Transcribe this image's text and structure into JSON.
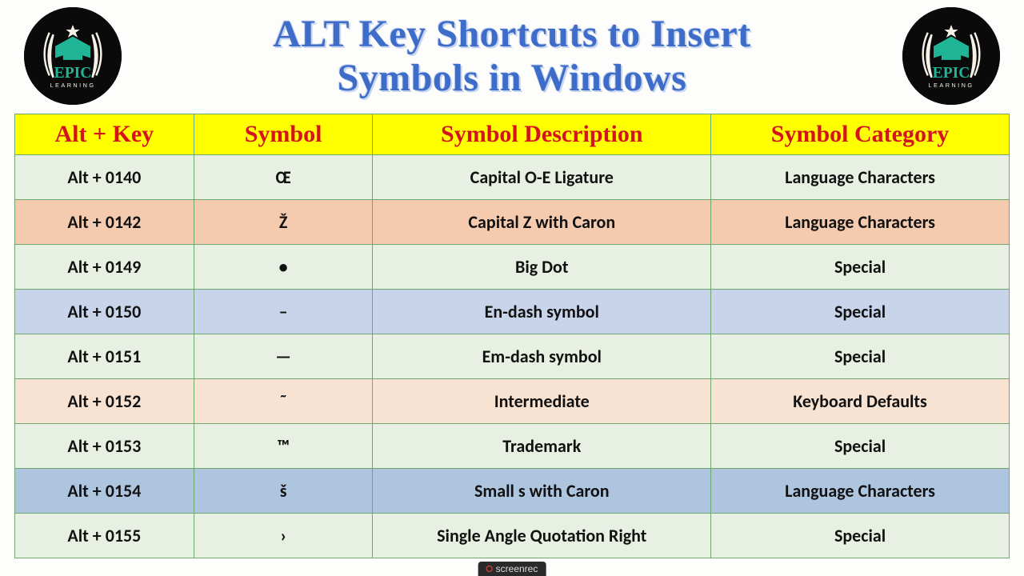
{
  "title": {
    "line1": "ALT Key Shortcuts to Insert",
    "line2": "Symbols in Windows"
  },
  "logo_text": {
    "brand": "EPIC",
    "sub": "LEARNING"
  },
  "headers": {
    "key": "Alt + Key",
    "symbol": "Symbol",
    "description": "Symbol Description",
    "category": "Symbol Category"
  },
  "rows": [
    {
      "key": "Alt + 0140",
      "symbol": "Œ",
      "description": "Capital O-E Ligature",
      "category": "Language Characters",
      "bg": "bg-a"
    },
    {
      "key": "Alt + 0142",
      "symbol": "Ž",
      "description": "Capital Z with Caron",
      "category": "Language Characters",
      "bg": "bg-b"
    },
    {
      "key": "Alt + 0149",
      "symbol": "•",
      "description": "Big Dot",
      "category": "Special",
      "bg": "bg-a"
    },
    {
      "key": "Alt + 0150",
      "symbol": "–",
      "description": "En-dash symbol",
      "category": "Special",
      "bg": "bg-c"
    },
    {
      "key": "Alt + 0151",
      "symbol": "—",
      "description": "Em-dash symbol",
      "category": "Special",
      "bg": "bg-a"
    },
    {
      "key": "Alt + 0152",
      "symbol": "˜",
      "description": "Intermediate",
      "category": "Keyboard Defaults",
      "bg": "bg-e"
    },
    {
      "key": "Alt + 0153",
      "symbol": "™",
      "description": "Trademark",
      "category": "Special",
      "bg": "bg-a"
    },
    {
      "key": "Alt + 0154",
      "symbol": "š",
      "description": "Small s with Caron",
      "category": "Language Characters",
      "bg": "bg-d"
    },
    {
      "key": "Alt + 0155",
      "symbol": "›",
      "description": "Single Angle Quotation Right",
      "category": "Special",
      "bg": "bg-a"
    }
  ],
  "watermark": "screenrec"
}
